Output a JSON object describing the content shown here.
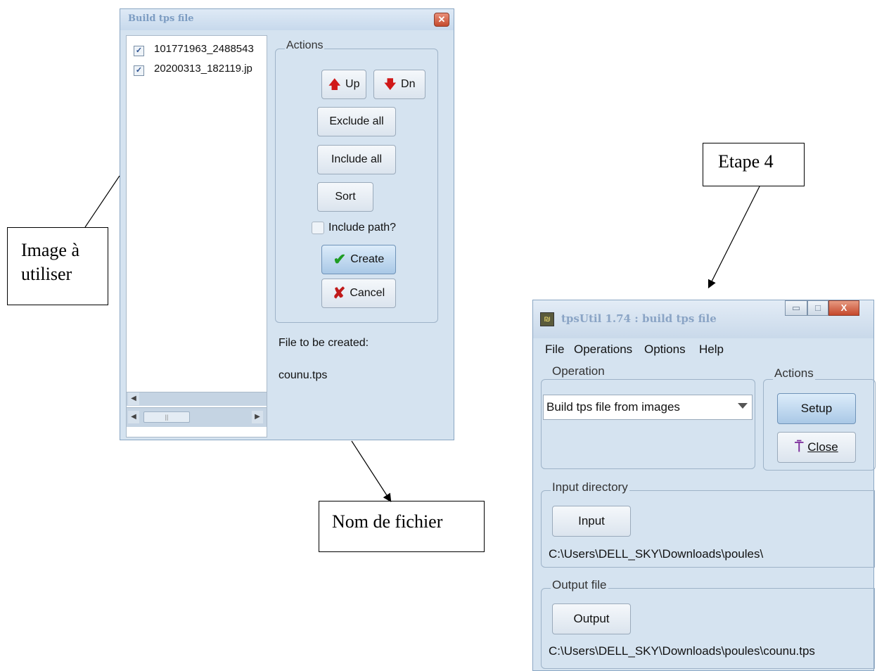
{
  "build_dialog": {
    "title": "Build tps file",
    "close_glyph": "✕",
    "files": [
      {
        "name": "101771963_2488543",
        "checked": true
      },
      {
        "name": "20200313_182119.jp",
        "checked": true
      }
    ],
    "check_glyph": "✓",
    "actions_label": "Actions",
    "up_label": "Up",
    "dn_label": "Dn",
    "exclude_all_label": "Exclude all",
    "include_all_label": "Include all",
    "sort_label": "Sort",
    "include_path_label": "Include path?",
    "create_label": "Create",
    "cancel_label": "Cancel",
    "file_to_be_created_label": "File to be created:",
    "file_name": "counu.tps"
  },
  "tpsutil_window": {
    "title": "tpsUtil 1.74 : build tps file",
    "menu": [
      "File",
      "Operations",
      "Options",
      "Help"
    ],
    "operation_label": "Operation",
    "operation_value": "Build tps file from images",
    "actions_label": "Actions",
    "setup_label": "Setup",
    "close_label": "Close",
    "input_directory_label": "Input directory",
    "input_button_label": "Input",
    "input_path": "C:\\Users\\DELL_SKY\\Downloads\\poules\\",
    "output_file_label": "Output file",
    "output_button_label": "Output",
    "output_path": "C:\\Users\\DELL_SKY\\Downloads\\poules\\counu.tps"
  },
  "annotations": {
    "etape": "Etape 4",
    "image_line1": "Image à",
    "image_line2": "utiliser",
    "nom_fichier": "Nom de fichier"
  },
  "icons": {
    "up": "arrow-up-icon",
    "dn": "arrow-down-icon",
    "create": "checkmark-icon",
    "cancel": "x-icon",
    "close": "door-exit-icon"
  },
  "colors": {
    "window_bg": "#d5e3f0",
    "arrow_red": "#d01818",
    "check_green": "#1f9c24"
  }
}
